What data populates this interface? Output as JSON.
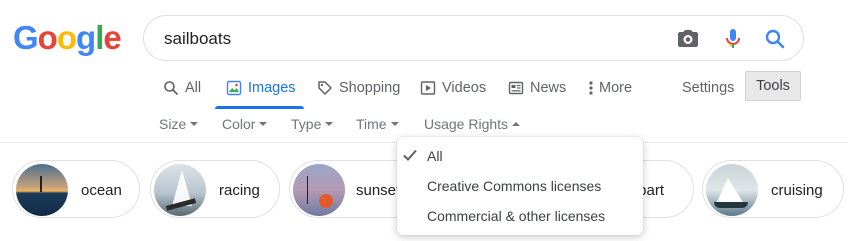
{
  "logo": {
    "letters": [
      "G",
      "o",
      "o",
      "g",
      "l",
      "e"
    ],
    "colors": [
      "#4285F4",
      "#EA4335",
      "#FBBC05",
      "#4285F4",
      "#34A853",
      "#EA4335"
    ]
  },
  "search": {
    "query": "sailboats",
    "icons": [
      "camera-icon",
      "microphone-icon",
      "search-icon"
    ]
  },
  "tabs": [
    {
      "label": "All",
      "icon": "search-icon",
      "active": false
    },
    {
      "label": "Images",
      "icon": "image-icon",
      "active": true
    },
    {
      "label": "Shopping",
      "icon": "tag-icon",
      "active": false
    },
    {
      "label": "Videos",
      "icon": "play-icon",
      "active": false
    },
    {
      "label": "News",
      "icon": "newspaper-icon",
      "active": false
    },
    {
      "label": "More",
      "icon": "more-vert-icon",
      "active": false
    }
  ],
  "toolbar": {
    "settings_label": "Settings",
    "tools_label": "Tools"
  },
  "filters": [
    {
      "label": "Size",
      "open": false
    },
    {
      "label": "Color",
      "open": false
    },
    {
      "label": "Type",
      "open": false
    },
    {
      "label": "Time",
      "open": false
    },
    {
      "label": "Usage Rights",
      "open": true
    }
  ],
  "chips": [
    {
      "label": "ocean"
    },
    {
      "label": "racing"
    },
    {
      "label": "sunset"
    },
    {
      "label": "clipart"
    },
    {
      "label": "cruising"
    }
  ],
  "usage_rights_menu": {
    "items": [
      {
        "label": "All",
        "checked": true
      },
      {
        "label": "Creative Commons licenses",
        "checked": false
      },
      {
        "label": "Commercial & other licenses",
        "checked": false
      }
    ]
  },
  "colors": {
    "accent": "#1a73e8",
    "text": "#3c4043",
    "muted": "#70757a"
  }
}
